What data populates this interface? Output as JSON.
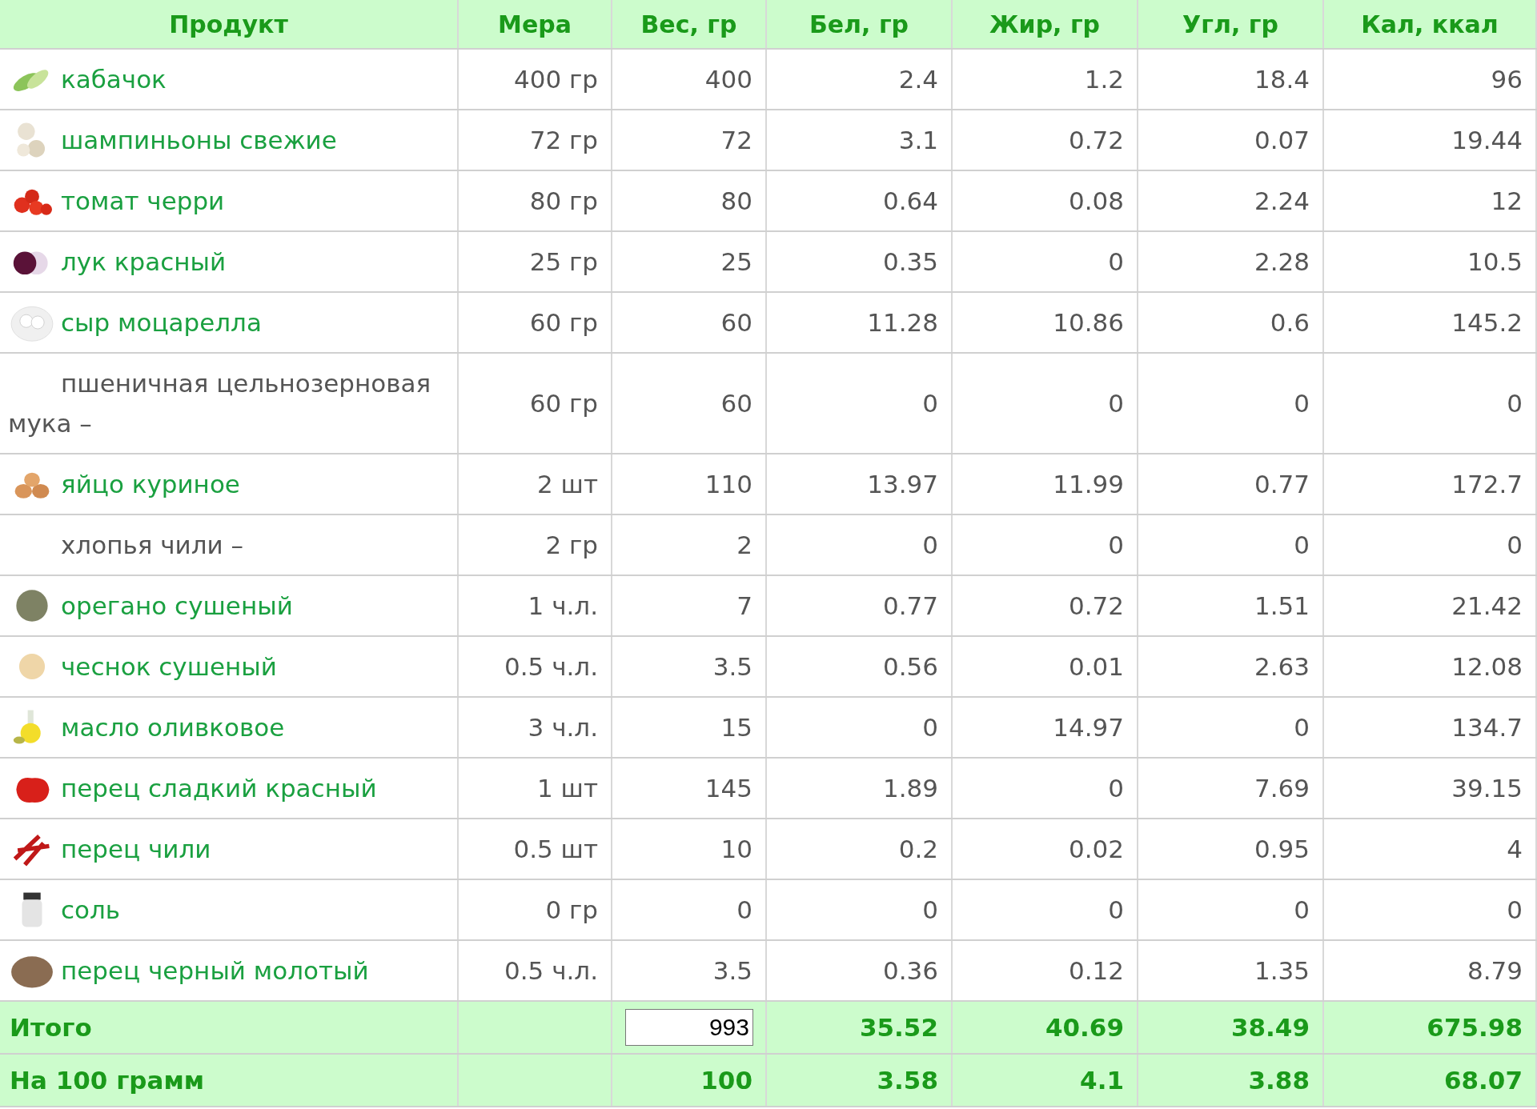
{
  "table": {
    "columns": [
      "Продукт",
      "Мера",
      "Вес, гр",
      "Бел, гр",
      "Жир, гр",
      "Угл, гр",
      "Кал, ккал"
    ],
    "rows": [
      {
        "kind": "link",
        "name": "кабачок",
        "measure": "400 гр",
        "weight": "400",
        "protein": "2.4",
        "fat": "1.2",
        "carbs": "18.4",
        "kcal": "96"
      },
      {
        "kind": "link",
        "name": "шампиньоны свежие",
        "measure": "72 гр",
        "weight": "72",
        "protein": "3.1",
        "fat": "0.72",
        "carbs": "0.07",
        "kcal": "19.44"
      },
      {
        "kind": "link",
        "name": "томат черри",
        "measure": "80 гр",
        "weight": "80",
        "protein": "0.64",
        "fat": "0.08",
        "carbs": "2.24",
        "kcal": "12"
      },
      {
        "kind": "link",
        "name": "лук красный",
        "measure": "25 гр",
        "weight": "25",
        "protein": "0.35",
        "fat": "0",
        "carbs": "2.28",
        "kcal": "10.5"
      },
      {
        "kind": "link",
        "name": "сыр моцарелла",
        "measure": "60 гр",
        "weight": "60",
        "protein": "11.28",
        "fat": "10.86",
        "carbs": "0.6",
        "kcal": "145.2"
      },
      {
        "kind": "plain",
        "name": "пшеничная цельнозерновая мука –",
        "measure": "60 гр",
        "weight": "60",
        "protein": "0",
        "fat": "0",
        "carbs": "0",
        "kcal": "0"
      },
      {
        "kind": "link",
        "name": "яйцо куриное",
        "measure": "2 шт",
        "weight": "110",
        "protein": "13.97",
        "fat": "11.99",
        "carbs": "0.77",
        "kcal": "172.7"
      },
      {
        "kind": "plain",
        "name": "хлопья чили –",
        "measure": "2 гр",
        "weight": "2",
        "protein": "0",
        "fat": "0",
        "carbs": "0",
        "kcal": "0"
      },
      {
        "kind": "link",
        "name": "орегано сушеный",
        "measure": "1 ч.л.",
        "weight": "7",
        "protein": "0.77",
        "fat": "0.72",
        "carbs": "1.51",
        "kcal": "21.42"
      },
      {
        "kind": "link",
        "name": "чеснок сушеный",
        "measure": "0.5 ч.л.",
        "weight": "3.5",
        "protein": "0.56",
        "fat": "0.01",
        "carbs": "2.63",
        "kcal": "12.08"
      },
      {
        "kind": "link",
        "name": "масло оливковое",
        "measure": "3 ч.л.",
        "weight": "15",
        "protein": "0",
        "fat": "14.97",
        "carbs": "0",
        "kcal": "134.7"
      },
      {
        "kind": "link",
        "name": "перец сладкий красный",
        "measure": "1 шт",
        "weight": "145",
        "protein": "1.89",
        "fat": "0",
        "carbs": "7.69",
        "kcal": "39.15"
      },
      {
        "kind": "link",
        "name": "перец чили",
        "measure": "0.5 шт",
        "weight": "10",
        "protein": "0.2",
        "fat": "0.02",
        "carbs": "0.95",
        "kcal": "4"
      },
      {
        "kind": "link",
        "name": "соль",
        "measure": "0 гр",
        "weight": "0",
        "protein": "0",
        "fat": "0",
        "carbs": "0",
        "kcal": "0"
      },
      {
        "kind": "link",
        "name": "перец черный молотый",
        "measure": "0.5 ч.л.",
        "weight": "3.5",
        "protein": "0.36",
        "fat": "0.12",
        "carbs": "1.35",
        "kcal": "8.79"
      }
    ],
    "totals": {
      "label": "Итого",
      "weight": "993",
      "protein": "35.52",
      "fat": "40.69",
      "carbs": "38.49",
      "kcal": "675.98"
    },
    "per100": {
      "label": "На 100 грамм",
      "weight": "100",
      "protein": "3.58",
      "fat": "4.1",
      "carbs": "3.88",
      "kcal": "68.07"
    }
  }
}
